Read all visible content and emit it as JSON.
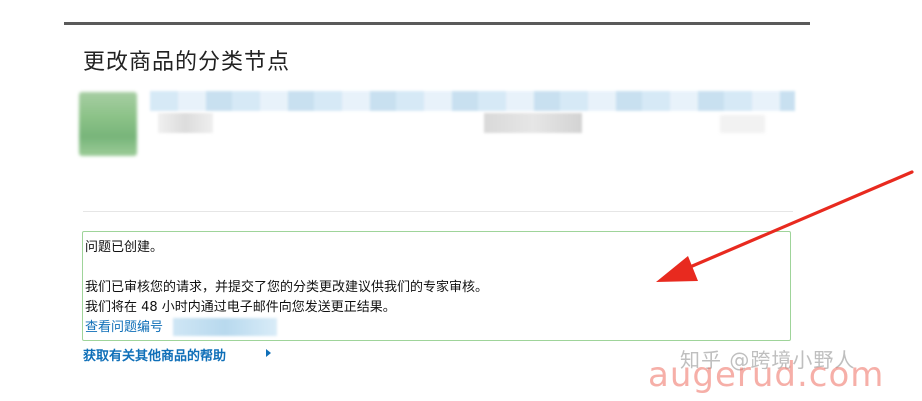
{
  "page": {
    "title": "更改商品的分类节点"
  },
  "message": {
    "line1": "问题已创建。",
    "line2": "我们已审核您的请求，并提交了您的分类更改建议供我们的专家审核。",
    "line3": "我们将在 48 小时内通过电子邮件向您发送更正结果。",
    "case_link_label": "查看问题编号"
  },
  "help_link": {
    "label": "获取有关其他商品的帮助"
  },
  "watermark": {
    "zhihu": "知乎 @跨境小野人",
    "site": "augerud.com"
  },
  "colors": {
    "link": "#0f6fb8",
    "box_border": "#9fd49a",
    "arrow": "#e82a1f"
  },
  "icons": {
    "help_link_chevron": "chevron-right-icon"
  }
}
